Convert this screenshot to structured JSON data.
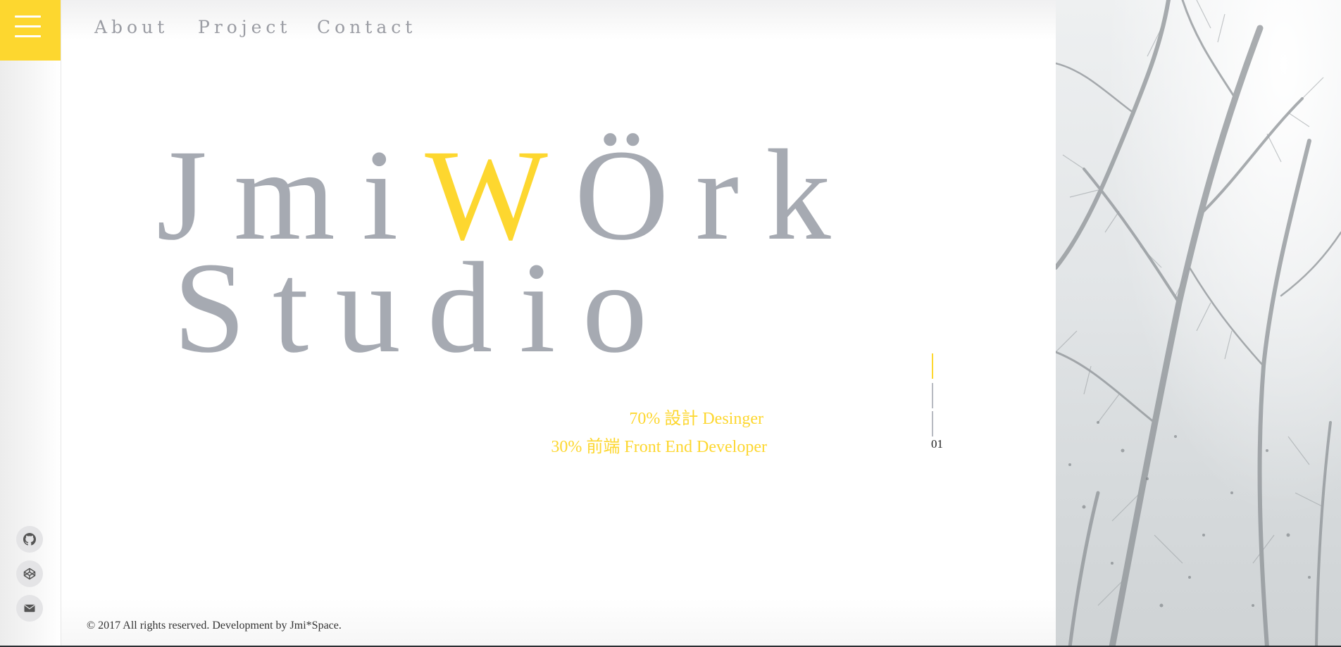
{
  "nav": {
    "items": [
      {
        "label": "About"
      },
      {
        "label": "Project"
      },
      {
        "label": "Contact"
      }
    ]
  },
  "hero": {
    "line1_part1": "Jmi",
    "line1_accent": "W",
    "line1_part2": "Örk",
    "line2": "Studio"
  },
  "tagline": {
    "line1": "70% 設計 Desinger",
    "line2": "30% 前端 Front End Developer"
  },
  "slider": {
    "current": "01"
  },
  "social": [
    {
      "icon": "github-icon"
    },
    {
      "icon": "codepen-icon"
    },
    {
      "icon": "mail-icon"
    }
  ],
  "footer": {
    "text": "© 2017 All rights reserved. Development by Jmi*Space."
  },
  "colors": {
    "accent": "#fdd72f",
    "title_gray": "#a6aab2",
    "nav_gray": "#9a9ca3"
  }
}
